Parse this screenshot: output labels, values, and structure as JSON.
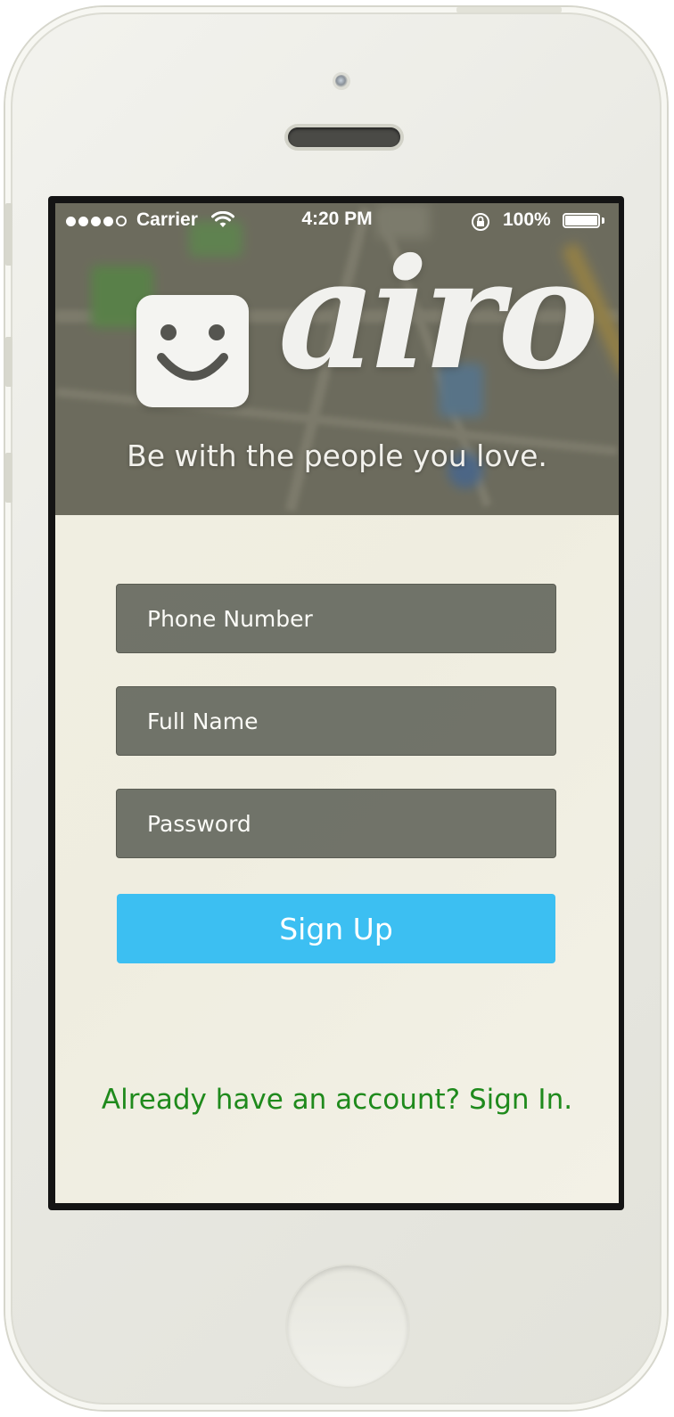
{
  "status_bar": {
    "carrier": "Carrier",
    "time": "4:20 PM",
    "battery": "100%",
    "signal_bars_filled": 4,
    "signal_bars_total": 5,
    "battery_level": 1.0
  },
  "brand": {
    "logo_text": "airo",
    "tagline": "Be with the people you love."
  },
  "form": {
    "phone_placeholder": "Phone Number",
    "name_placeholder": "Full Name",
    "password_placeholder": "Password",
    "submit_label": "Sign Up"
  },
  "footer": {
    "signin_link": "Already have an account? Sign In."
  },
  "colors": {
    "accent": "#3cbff2",
    "link": "#1f8a1c",
    "field_bg": "#5f6258"
  },
  "icons": {
    "wifi": "wifi-icon",
    "lock": "rotation-lock-icon",
    "battery": "battery-icon",
    "logo": "smiley-logo-icon"
  }
}
